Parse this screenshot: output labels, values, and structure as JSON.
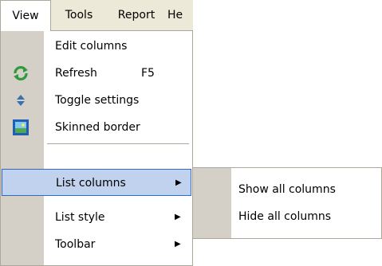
{
  "menubar": {
    "items": [
      "View",
      "Tools",
      "Report",
      "He"
    ]
  },
  "view_menu": {
    "items": [
      {
        "label": "Edit columns",
        "icon": null,
        "shortcut": ""
      },
      {
        "label": "Refresh",
        "icon": "refresh-icon",
        "shortcut": "F5"
      },
      {
        "label": "Toggle settings",
        "icon": "toggle-icon",
        "shortcut": ""
      },
      {
        "label": "Skinned border",
        "icon": "skinned-border-icon",
        "shortcut": ""
      },
      {
        "label": "List columns",
        "submenu": true,
        "highlighted": true
      },
      {
        "label": "List style",
        "submenu": true
      },
      {
        "label": "Toolbar",
        "submenu": true
      }
    ]
  },
  "list_columns_submenu": {
    "items": [
      "Show all columns",
      "Hide all columns"
    ]
  },
  "colors": {
    "menu_bg": "#ffffff",
    "gutter": "#d4d0c8",
    "highlight_fill": "#c1d2ee",
    "highlight_border": "#316ac5",
    "menubar_bg": "#ece9d8"
  }
}
